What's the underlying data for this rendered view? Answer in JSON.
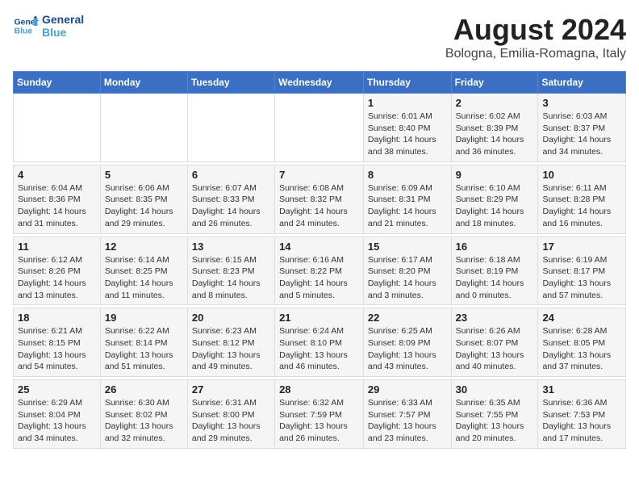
{
  "header": {
    "logo_line1": "General",
    "logo_line2": "Blue",
    "main_title": "August 2024",
    "subtitle": "Bologna, Emilia-Romagna, Italy"
  },
  "days_of_week": [
    "Sunday",
    "Monday",
    "Tuesday",
    "Wednesday",
    "Thursday",
    "Friday",
    "Saturday"
  ],
  "weeks": [
    [
      {
        "day": "",
        "info": ""
      },
      {
        "day": "",
        "info": ""
      },
      {
        "day": "",
        "info": ""
      },
      {
        "day": "",
        "info": ""
      },
      {
        "day": "1",
        "info": "Sunrise: 6:01 AM\nSunset: 8:40 PM\nDaylight: 14 hours\nand 38 minutes."
      },
      {
        "day": "2",
        "info": "Sunrise: 6:02 AM\nSunset: 8:39 PM\nDaylight: 14 hours\nand 36 minutes."
      },
      {
        "day": "3",
        "info": "Sunrise: 6:03 AM\nSunset: 8:37 PM\nDaylight: 14 hours\nand 34 minutes."
      }
    ],
    [
      {
        "day": "4",
        "info": "Sunrise: 6:04 AM\nSunset: 8:36 PM\nDaylight: 14 hours\nand 31 minutes."
      },
      {
        "day": "5",
        "info": "Sunrise: 6:06 AM\nSunset: 8:35 PM\nDaylight: 14 hours\nand 29 minutes."
      },
      {
        "day": "6",
        "info": "Sunrise: 6:07 AM\nSunset: 8:33 PM\nDaylight: 14 hours\nand 26 minutes."
      },
      {
        "day": "7",
        "info": "Sunrise: 6:08 AM\nSunset: 8:32 PM\nDaylight: 14 hours\nand 24 minutes."
      },
      {
        "day": "8",
        "info": "Sunrise: 6:09 AM\nSunset: 8:31 PM\nDaylight: 14 hours\nand 21 minutes."
      },
      {
        "day": "9",
        "info": "Sunrise: 6:10 AM\nSunset: 8:29 PM\nDaylight: 14 hours\nand 18 minutes."
      },
      {
        "day": "10",
        "info": "Sunrise: 6:11 AM\nSunset: 8:28 PM\nDaylight: 14 hours\nand 16 minutes."
      }
    ],
    [
      {
        "day": "11",
        "info": "Sunrise: 6:12 AM\nSunset: 8:26 PM\nDaylight: 14 hours\nand 13 minutes."
      },
      {
        "day": "12",
        "info": "Sunrise: 6:14 AM\nSunset: 8:25 PM\nDaylight: 14 hours\nand 11 minutes."
      },
      {
        "day": "13",
        "info": "Sunrise: 6:15 AM\nSunset: 8:23 PM\nDaylight: 14 hours\nand 8 minutes."
      },
      {
        "day": "14",
        "info": "Sunrise: 6:16 AM\nSunset: 8:22 PM\nDaylight: 14 hours\nand 5 minutes."
      },
      {
        "day": "15",
        "info": "Sunrise: 6:17 AM\nSunset: 8:20 PM\nDaylight: 14 hours\nand 3 minutes."
      },
      {
        "day": "16",
        "info": "Sunrise: 6:18 AM\nSunset: 8:19 PM\nDaylight: 14 hours\nand 0 minutes."
      },
      {
        "day": "17",
        "info": "Sunrise: 6:19 AM\nSunset: 8:17 PM\nDaylight: 13 hours\nand 57 minutes."
      }
    ],
    [
      {
        "day": "18",
        "info": "Sunrise: 6:21 AM\nSunset: 8:15 PM\nDaylight: 13 hours\nand 54 minutes."
      },
      {
        "day": "19",
        "info": "Sunrise: 6:22 AM\nSunset: 8:14 PM\nDaylight: 13 hours\nand 51 minutes."
      },
      {
        "day": "20",
        "info": "Sunrise: 6:23 AM\nSunset: 8:12 PM\nDaylight: 13 hours\nand 49 minutes."
      },
      {
        "day": "21",
        "info": "Sunrise: 6:24 AM\nSunset: 8:10 PM\nDaylight: 13 hours\nand 46 minutes."
      },
      {
        "day": "22",
        "info": "Sunrise: 6:25 AM\nSunset: 8:09 PM\nDaylight: 13 hours\nand 43 minutes."
      },
      {
        "day": "23",
        "info": "Sunrise: 6:26 AM\nSunset: 8:07 PM\nDaylight: 13 hours\nand 40 minutes."
      },
      {
        "day": "24",
        "info": "Sunrise: 6:28 AM\nSunset: 8:05 PM\nDaylight: 13 hours\nand 37 minutes."
      }
    ],
    [
      {
        "day": "25",
        "info": "Sunrise: 6:29 AM\nSunset: 8:04 PM\nDaylight: 13 hours\nand 34 minutes."
      },
      {
        "day": "26",
        "info": "Sunrise: 6:30 AM\nSunset: 8:02 PM\nDaylight: 13 hours\nand 32 minutes."
      },
      {
        "day": "27",
        "info": "Sunrise: 6:31 AM\nSunset: 8:00 PM\nDaylight: 13 hours\nand 29 minutes."
      },
      {
        "day": "28",
        "info": "Sunrise: 6:32 AM\nSunset: 7:59 PM\nDaylight: 13 hours\nand 26 minutes."
      },
      {
        "day": "29",
        "info": "Sunrise: 6:33 AM\nSunset: 7:57 PM\nDaylight: 13 hours\nand 23 minutes."
      },
      {
        "day": "30",
        "info": "Sunrise: 6:35 AM\nSunset: 7:55 PM\nDaylight: 13 hours\nand 20 minutes."
      },
      {
        "day": "31",
        "info": "Sunrise: 6:36 AM\nSunset: 7:53 PM\nDaylight: 13 hours\nand 17 minutes."
      }
    ]
  ]
}
